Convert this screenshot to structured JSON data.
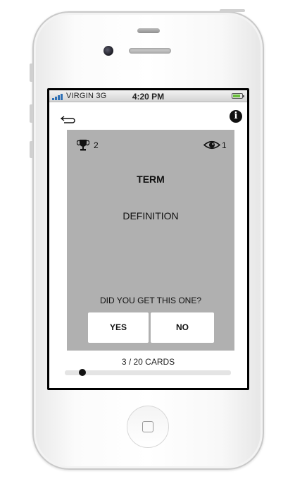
{
  "status_bar": {
    "carrier": "VIRGIN",
    "network": "3G",
    "time": "4:20 PM",
    "battery_level": 0.85
  },
  "header": {
    "back_icon": "back-arrow-icon",
    "info_icon": "info-icon",
    "info_glyph": "i"
  },
  "card": {
    "trophy_icon": "trophy-icon",
    "trophy_count": "2",
    "eye_icon": "eye-icon",
    "view_count": "1",
    "term": "TERM",
    "definition": "DEFINITION",
    "question": "DID YOU GET THIS ONE?",
    "yes_label": "YES",
    "no_label": "NO"
  },
  "progress": {
    "label": "3 / 20 CARDS",
    "current": 3,
    "total": 20
  },
  "colors": {
    "card_bg": "#b0b0b0",
    "signal": "#2d6fb5",
    "battery": "#6bbf3c"
  }
}
